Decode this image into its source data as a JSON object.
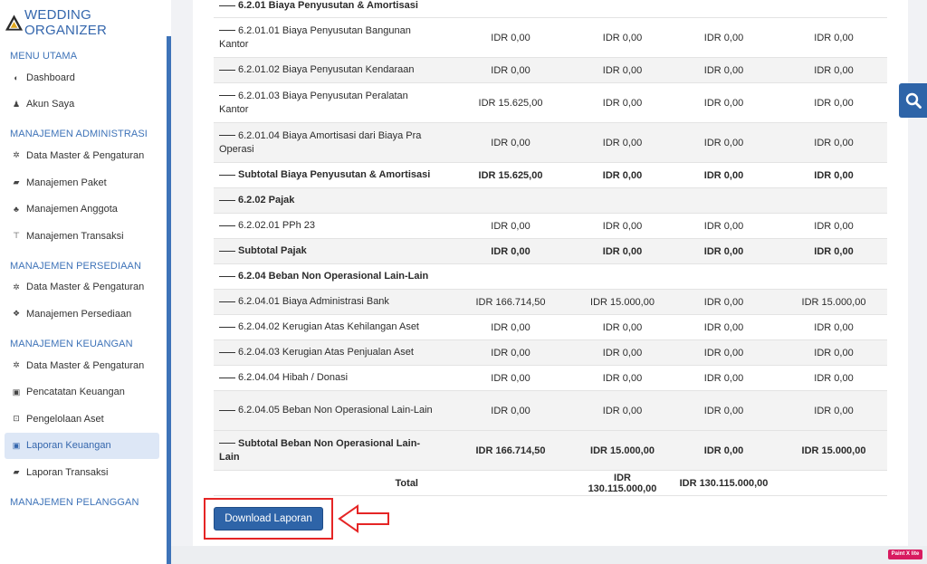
{
  "app": {
    "title": "WEDDING ORGANIZER"
  },
  "sidebar": {
    "sections": [
      {
        "title": "MENU UTAMA",
        "items": [
          {
            "label": "Dashboard",
            "icon": "dashboard-icon"
          },
          {
            "label": "Akun Saya",
            "icon": "user-icon"
          }
        ]
      },
      {
        "title": "MANAJEMEN ADMINISTRASI",
        "items": [
          {
            "label": "Data Master & Pengaturan",
            "icon": "cogs-icon"
          },
          {
            "label": "Manajemen Paket",
            "icon": "book-icon"
          },
          {
            "label": "Manajemen Anggota",
            "icon": "users-icon"
          },
          {
            "label": "Manajemen Transaksi",
            "icon": "cart-icon"
          }
        ]
      },
      {
        "title": "MANAJEMEN PERSEDIAAN",
        "items": [
          {
            "label": "Data Master & Pengaturan",
            "icon": "cogs-icon"
          },
          {
            "label": "Manajemen Persediaan",
            "icon": "cubes-icon"
          }
        ]
      },
      {
        "title": "MANAJEMEN KEUANGAN",
        "items": [
          {
            "label": "Data Master & Pengaturan",
            "icon": "cogs-icon"
          },
          {
            "label": "Pencatatan Keuangan",
            "icon": "money-icon"
          },
          {
            "label": "Pengelolaan Aset",
            "icon": "hdd-icon"
          },
          {
            "label": "Laporan Keuangan",
            "icon": "money-icon",
            "active": true
          },
          {
            "label": "Laporan Transaksi",
            "icon": "book-icon"
          }
        ]
      },
      {
        "title": "MANAJEMEN PELANGGAN",
        "items": []
      }
    ]
  },
  "report": {
    "header_partial": "6.2.01 Biaya Penyusutan & Amortisasi",
    "rows": [
      {
        "label": "6.2.01.01 Biaya Penyusutan Bangunan Kantor",
        "v": [
          "IDR 0,00",
          "IDR 0,00",
          "IDR 0,00",
          "IDR 0,00"
        ]
      },
      {
        "label": "6.2.01.02 Biaya Penyusutan Kendaraan",
        "v": [
          "IDR 0,00",
          "IDR 0,00",
          "IDR 0,00",
          "IDR 0,00"
        ]
      },
      {
        "label": "6.2.01.03 Biaya Penyusutan Peralatan Kantor",
        "v": [
          "IDR 15.625,00",
          "IDR 0,00",
          "IDR 0,00",
          "IDR 0,00"
        ]
      },
      {
        "label": "6.2.01.04 Biaya Amortisasi dari Biaya Pra Operasi",
        "v": [
          "IDR 0,00",
          "IDR 0,00",
          "IDR 0,00",
          "IDR 0,00"
        ]
      },
      {
        "label": "Subtotal Biaya Penyusutan & Amortisasi",
        "v": [
          "IDR 15.625,00",
          "IDR 0,00",
          "IDR 0,00",
          "IDR 0,00"
        ],
        "bold": true
      },
      {
        "label": "6.2.02 Pajak",
        "v": [
          "",
          "",
          "",
          ""
        ],
        "bold": true
      },
      {
        "label": "6.2.02.01 PPh 23",
        "v": [
          "IDR 0,00",
          "IDR 0,00",
          "IDR 0,00",
          "IDR 0,00"
        ]
      },
      {
        "label": "Subtotal Pajak",
        "v": [
          "IDR 0,00",
          "IDR 0,00",
          "IDR 0,00",
          "IDR 0,00"
        ],
        "bold": true
      },
      {
        "label": "6.2.04 Beban Non Operasional Lain-Lain",
        "v": [
          "",
          "",
          "",
          ""
        ],
        "bold": true
      },
      {
        "label": "6.2.04.01 Biaya Administrasi Bank",
        "v": [
          "IDR 166.714,50",
          "IDR 15.000,00",
          "IDR 0,00",
          "IDR 15.000,00"
        ]
      },
      {
        "label": "6.2.04.02 Kerugian Atas Kehilangan Aset",
        "v": [
          "IDR 0,00",
          "IDR 0,00",
          "IDR 0,00",
          "IDR 0,00"
        ]
      },
      {
        "label": "6.2.04.03 Kerugian Atas Penjualan Aset",
        "v": [
          "IDR 0,00",
          "IDR 0,00",
          "IDR 0,00",
          "IDR 0,00"
        ]
      },
      {
        "label": "6.2.04.04 Hibah / Donasi",
        "v": [
          "IDR 0,00",
          "IDR 0,00",
          "IDR 0,00",
          "IDR 0,00"
        ]
      },
      {
        "label": "6.2.04.05 Beban Non Operasional Lain-Lain",
        "v": [
          "IDR 0,00",
          "IDR 0,00",
          "IDR 0,00",
          "IDR 0,00"
        ]
      },
      {
        "label": "Subtotal Beban Non Operasional Lain-Lain",
        "v": [
          "IDR 166.714,50",
          "IDR 15.000,00",
          "IDR 0,00",
          "IDR 15.000,00"
        ],
        "bold": true
      }
    ],
    "total": {
      "label": "Total",
      "v": [
        "",
        "IDR 130.115.000,00",
        "IDR 130.115.000,00",
        ""
      ]
    }
  },
  "actions": {
    "download_label": "Download Laporan"
  },
  "badge": {
    "text": "Paint X lite"
  },
  "colors": {
    "accent": "#2e64a8",
    "highlight": "#e52525"
  }
}
